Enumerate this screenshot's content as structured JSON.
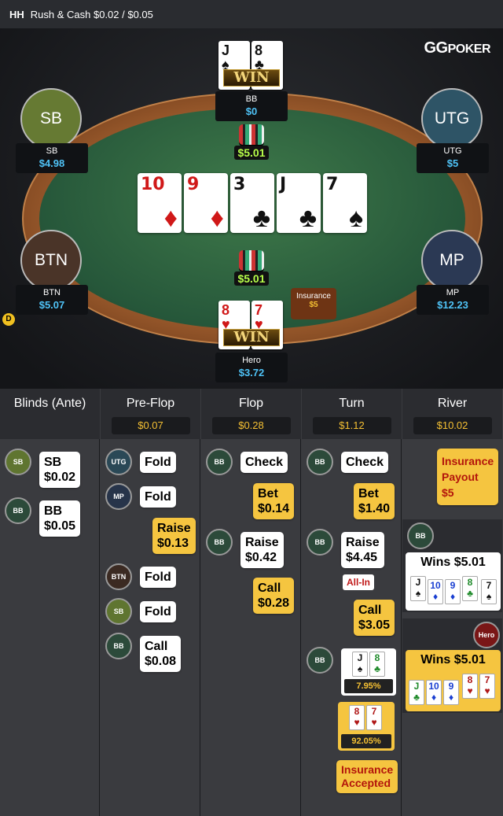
{
  "header": {
    "prefix": "HH",
    "game": "Rush & Cash $0.02 / $0.05"
  },
  "logo": {
    "brand": "GGPOKER",
    "gg": "GG",
    "rest": "POKER"
  },
  "seats": {
    "bb": {
      "pos": "BB",
      "stack": "$0"
    },
    "sb": {
      "pos": "SB",
      "name": "SB",
      "stack": "$4.98"
    },
    "utg": {
      "pos": "UTG",
      "name": "UTG",
      "stack": "$5"
    },
    "btn": {
      "pos": "BTN",
      "name": "BTN",
      "stack": "$5.07"
    },
    "mp": {
      "pos": "MP",
      "name": "MP",
      "stack": "$12.23"
    },
    "hero": {
      "name": "Hero",
      "stack": "$3.72"
    }
  },
  "dealer_button": "D",
  "pots": {
    "top": "$5.01",
    "center": "$5.01"
  },
  "board": [
    {
      "rank": "10",
      "suit": "♦",
      "color": "red"
    },
    {
      "rank": "9",
      "suit": "♦",
      "color": "red"
    },
    {
      "rank": "3",
      "suit": "♣",
      "color": "blk"
    },
    {
      "rank": "J",
      "suit": "♣",
      "color": "blk"
    },
    {
      "rank": "7",
      "suit": "♠",
      "color": "blk"
    }
  ],
  "bb_hole": [
    {
      "rank": "J",
      "suit": "♠"
    },
    {
      "rank": "8",
      "suit": "♣"
    }
  ],
  "hero_hole": [
    {
      "rank": "8",
      "suit": "♥"
    },
    {
      "rank": "7",
      "suit": "♥"
    }
  ],
  "win_label": "WIN",
  "insurance_tag": {
    "label": "Insurance",
    "value": "$5"
  },
  "streets": [
    {
      "name": "Blinds (Ante)",
      "pot": ""
    },
    {
      "name": "Pre-Flop",
      "pot": "$0.07"
    },
    {
      "name": "Flop",
      "pot": "$0.28"
    },
    {
      "name": "Turn",
      "pot": "$1.12"
    },
    {
      "name": "River",
      "pot": "$10.02"
    }
  ],
  "actions": {
    "blinds": [
      {
        "pos": "SB",
        "line1": "SB",
        "line2": "$0.02"
      },
      {
        "pos": "BB",
        "line1": "BB",
        "line2": "$0.05"
      }
    ],
    "preflop": [
      {
        "pos": "UTG",
        "line1": "Fold"
      },
      {
        "pos": "MP",
        "line1": "Fold"
      },
      {
        "pos": "",
        "line1": "Raise",
        "line2": "$0.13"
      },
      {
        "pos": "BTN",
        "line1": "Fold"
      },
      {
        "pos": "SB",
        "line1": "Fold"
      },
      {
        "pos": "BB",
        "line1": "Call",
        "line2": "$0.08"
      }
    ],
    "flop": [
      {
        "pos": "BB",
        "line1": "Check"
      },
      {
        "pos": "",
        "line1": "Bet",
        "line2": "$0.14"
      },
      {
        "pos": "BB",
        "line1": "Raise",
        "line2": "$0.42"
      },
      {
        "pos": "",
        "line1": "Call",
        "line2": "$0.28"
      }
    ],
    "turn": [
      {
        "pos": "BB",
        "line1": "Check"
      },
      {
        "pos": "",
        "line1": "Bet",
        "line2": "$1.40"
      },
      {
        "pos": "BB",
        "line1": "Raise",
        "line2": "$4.45"
      },
      {
        "allin": "All-In"
      },
      {
        "pos": "",
        "line1": "Call",
        "line2": "$3.05"
      },
      {
        "pos": "BB",
        "equity": "7.95%"
      },
      {
        "pos": "",
        "equity": "92.05%"
      },
      {
        "line1": "Insurance",
        "line2": "Accepted"
      }
    ],
    "river": {
      "payout": {
        "line1": "Insurance",
        "line2": "Payout",
        "line3": "$5"
      },
      "bb_pos": "BB",
      "bb_win": "Wins $5.01",
      "hero_pos": "Hero",
      "hero_win": "Wins $5.01"
    }
  },
  "mini": {
    "bb_best": [
      {
        "r": "J",
        "s": "♠",
        "c": "#111"
      },
      {
        "r": "10",
        "s": "♦",
        "c": "#1a3fd1"
      },
      {
        "r": "9",
        "s": "♦",
        "c": "#1a3fd1"
      },
      {
        "r": "8",
        "s": "♣",
        "c": "#1f8a2a"
      },
      {
        "r": "7",
        "s": "♠",
        "c": "#111"
      }
    ],
    "hero_best": [
      {
        "r": "J",
        "s": "♣",
        "c": "#1f8a2a"
      },
      {
        "r": "10",
        "s": "♦",
        "c": "#1a3fd1"
      },
      {
        "r": "9",
        "s": "♦",
        "c": "#1a3fd1"
      },
      {
        "r": "8",
        "s": "♥",
        "c": "#b01818"
      },
      {
        "r": "7",
        "s": "♥",
        "c": "#b01818"
      }
    ],
    "bb_hand": [
      {
        "r": "J",
        "s": "♠",
        "c": "#111"
      },
      {
        "r": "8",
        "s": "♣",
        "c": "#1f8a2a"
      }
    ],
    "hero_hand": [
      {
        "r": "8",
        "s": "♥",
        "c": "#b01818"
      },
      {
        "r": "7",
        "s": "♥",
        "c": "#b01818"
      }
    ]
  }
}
